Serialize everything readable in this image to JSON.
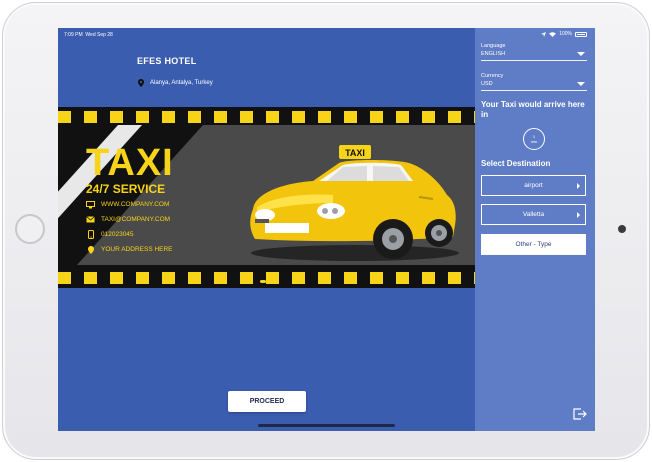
{
  "status_bar": {
    "time": "7:09 PM",
    "date": "Wed Sep 28",
    "battery": "100%"
  },
  "hotel": {
    "name": "EFES HOTEL",
    "location": "Alanya, Antalya, Turkey"
  },
  "banner": {
    "title": "TAXI",
    "subtitle": "24/7 SERVICE",
    "roof_sign": "TAXI",
    "website": "WWW.COMPANY.COM",
    "email": "TAXI@COMPANY.COM",
    "phone": "012023045",
    "address": "YOUR ADDRESS HERE"
  },
  "proceed_label": "PROCEED",
  "sidebar": {
    "language_label": "Language",
    "language_value": "ENGLISH",
    "currency_label": "Currency",
    "currency_value": "USD",
    "arrive_text": "Your Taxi would arrive here in",
    "arrive_value": "1",
    "arrive_unit": "min",
    "select_destination": "Select Destination",
    "destinations": [
      {
        "label": "airport"
      },
      {
        "label": "Valletta"
      },
      {
        "label": "Other - Type"
      }
    ]
  },
  "colors": {
    "screen_bg": "#3b5db0",
    "sidebar_bg": "#5f7cc6",
    "taxi_yellow": "#f7d418"
  }
}
